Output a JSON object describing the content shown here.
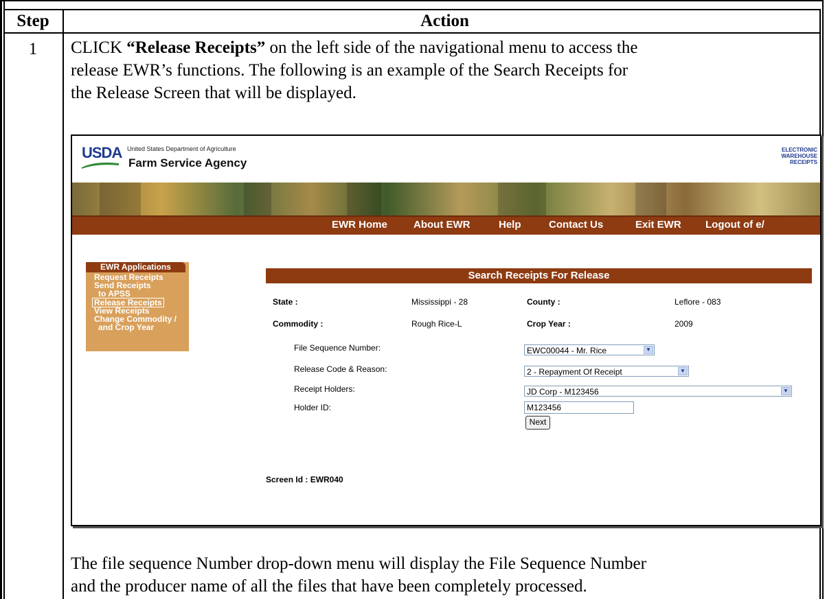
{
  "table": {
    "header_step": "Step",
    "header_action": "Action",
    "step_number": "1"
  },
  "intro": {
    "prefix": "CLICK ",
    "bold": "“Release Receipts”",
    "line1_rest": " on the left side of the navigational menu to access the",
    "line2": "release EWR’s functions.  The following is an example of the Search Receipts for",
    "line3": "the Release Screen that will be displayed."
  },
  "screenshot": {
    "usda_logo": "USDA",
    "department": "United States Department of Agriculture",
    "agency": "Farm Service Agency",
    "ewr_logo": [
      "ELECTRONIC",
      "WAREHOUSE",
      "RECEIPTS"
    ],
    "nav": [
      "EWR Home",
      "About EWR",
      "Help",
      "Contact Us",
      "Exit EWR",
      "Logout of e/"
    ],
    "sidebar": {
      "title": "EWR Applications",
      "items": [
        "Request Receipts",
        "Send Receipts",
        "to APSS",
        "Release Receipts",
        "View Receipts",
        "Change Commodity /",
        "and Crop Year"
      ]
    },
    "page_title": "Search Receipts For Release",
    "info": {
      "state_label": "State :",
      "state_value": "Mississippi - 28",
      "county_label": "County :",
      "county_value": "Leflore - 083",
      "commodity_label": "Commodity :",
      "commodity_value": "Rough Rice-L",
      "crop_year_label": "Crop Year :",
      "crop_year_value": "2009"
    },
    "form": {
      "file_seq_label": "File Sequence Number:",
      "file_seq_value": "EWC00044 - Mr. Rice",
      "release_code_label": "Release Code & Reason:",
      "release_code_value": "2 - Repayment Of Receipt",
      "holders_label": "Receipt Holders:",
      "holders_value": "JD Corp - M123456",
      "holder_id_label": "Holder ID:",
      "holder_id_value": "M123456",
      "next_label": "Next"
    },
    "screen_id": "Screen Id : EWR040"
  },
  "outro": {
    "line1": "The file sequence Number drop-down menu will display the File Sequence Number",
    "line2": "and the producer name of all the files that have been completely processed."
  },
  "colors": {
    "nav_brown": "#8e3b12",
    "sidebar_tan": "#d9a05b",
    "usda_blue": "#1f3b8f"
  }
}
